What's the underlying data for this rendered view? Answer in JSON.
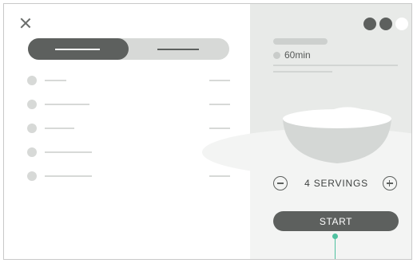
{
  "recipe": {
    "time": "60min",
    "servings": "4 SERVINGS",
    "start_label": "START"
  },
  "view_toggle": {
    "options": [
      "option-1",
      "option-2"
    ],
    "selected_index": 0
  },
  "ingredients_count": 5,
  "pagination": {
    "dots": [
      {
        "color": "#5d605e"
      },
      {
        "color": "#5d605e"
      },
      {
        "color": "#ffffff"
      }
    ],
    "active_index": 2
  },
  "colors": {
    "accent": "#4fc1a0",
    "dark": "#5d605e",
    "placeholder": "#d7d9d7",
    "panel": "#e8eae8"
  },
  "icons": {
    "close": "close-icon",
    "minus": "minus-icon",
    "plus": "plus-icon"
  }
}
